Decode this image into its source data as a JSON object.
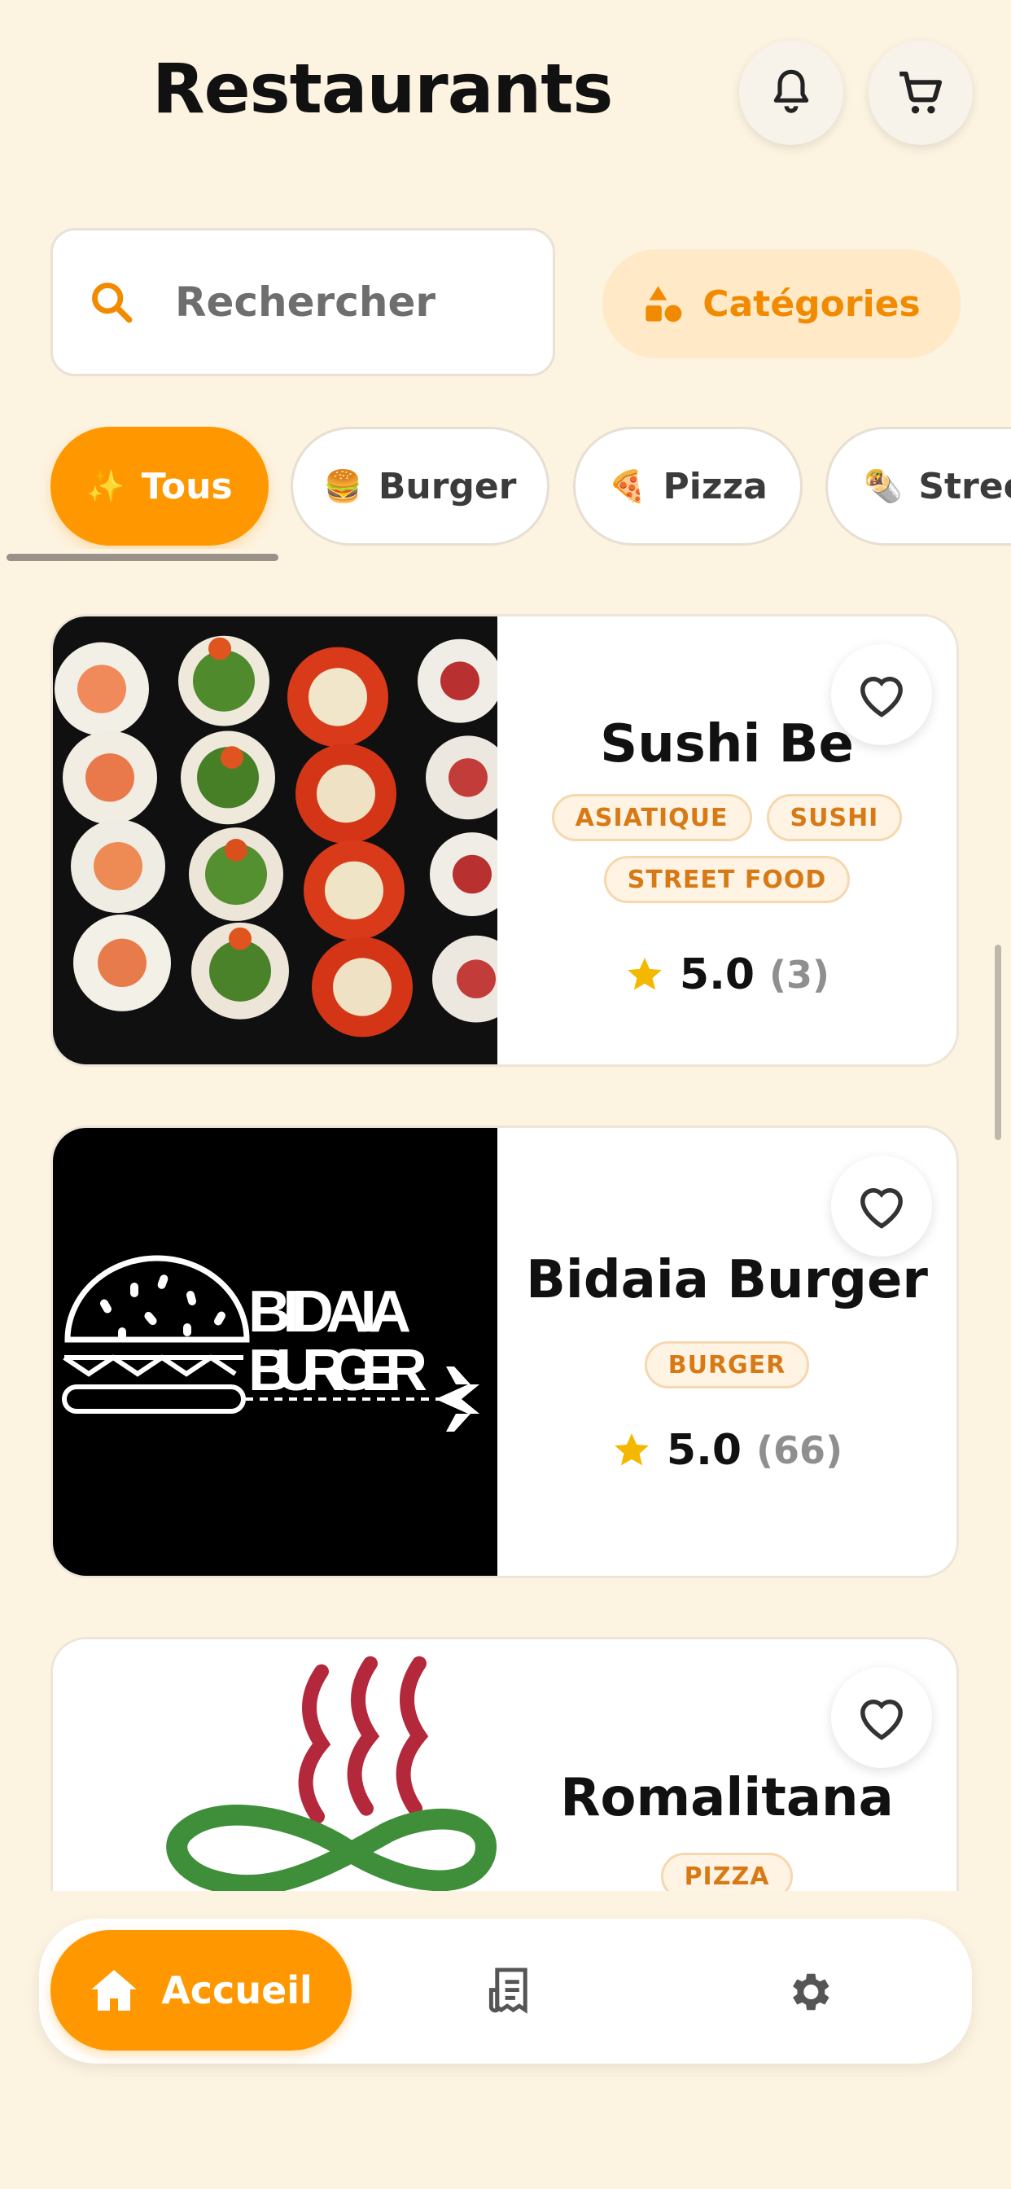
{
  "header": {
    "title": "Restaurants",
    "bell_icon": "bell-icon",
    "cart_icon": "cart-icon"
  },
  "search": {
    "placeholder": "Rechercher",
    "icon": "search-icon"
  },
  "categories_button": {
    "label": "Catégories",
    "icon": "shapes-icon"
  },
  "filter_chips": [
    {
      "emoji": "✨",
      "label": "Tous",
      "active": true
    },
    {
      "emoji": "🍔",
      "label": "Burger",
      "active": false
    },
    {
      "emoji": "🍕",
      "label": "Pizza",
      "active": false
    },
    {
      "emoji": "🌯",
      "label": "Street",
      "active": false
    }
  ],
  "restaurants": [
    {
      "name": "Sushi Be",
      "tags": [
        "ASIATIQUE",
        "SUSHI",
        "STREET FOOD"
      ],
      "rating": "5.0",
      "reviews": "(3)"
    },
    {
      "name": "Bidaia Burger",
      "tags": [
        "BURGER"
      ],
      "rating": "5.0",
      "reviews": "(66)",
      "logo_text": [
        "BIDAIA",
        "BURGER"
      ]
    },
    {
      "name": "Romalitana",
      "tags": [
        "PIZZA"
      ]
    }
  ],
  "bottom_nav": {
    "home_label": "Accueil",
    "home_icon": "home-icon",
    "orders_icon": "receipt-icon",
    "settings_icon": "gear-icon"
  },
  "colors": {
    "accent": "#ff9800",
    "background": "#fdf3e1",
    "tag_text": "#d77a16",
    "star": "#f5b800"
  }
}
